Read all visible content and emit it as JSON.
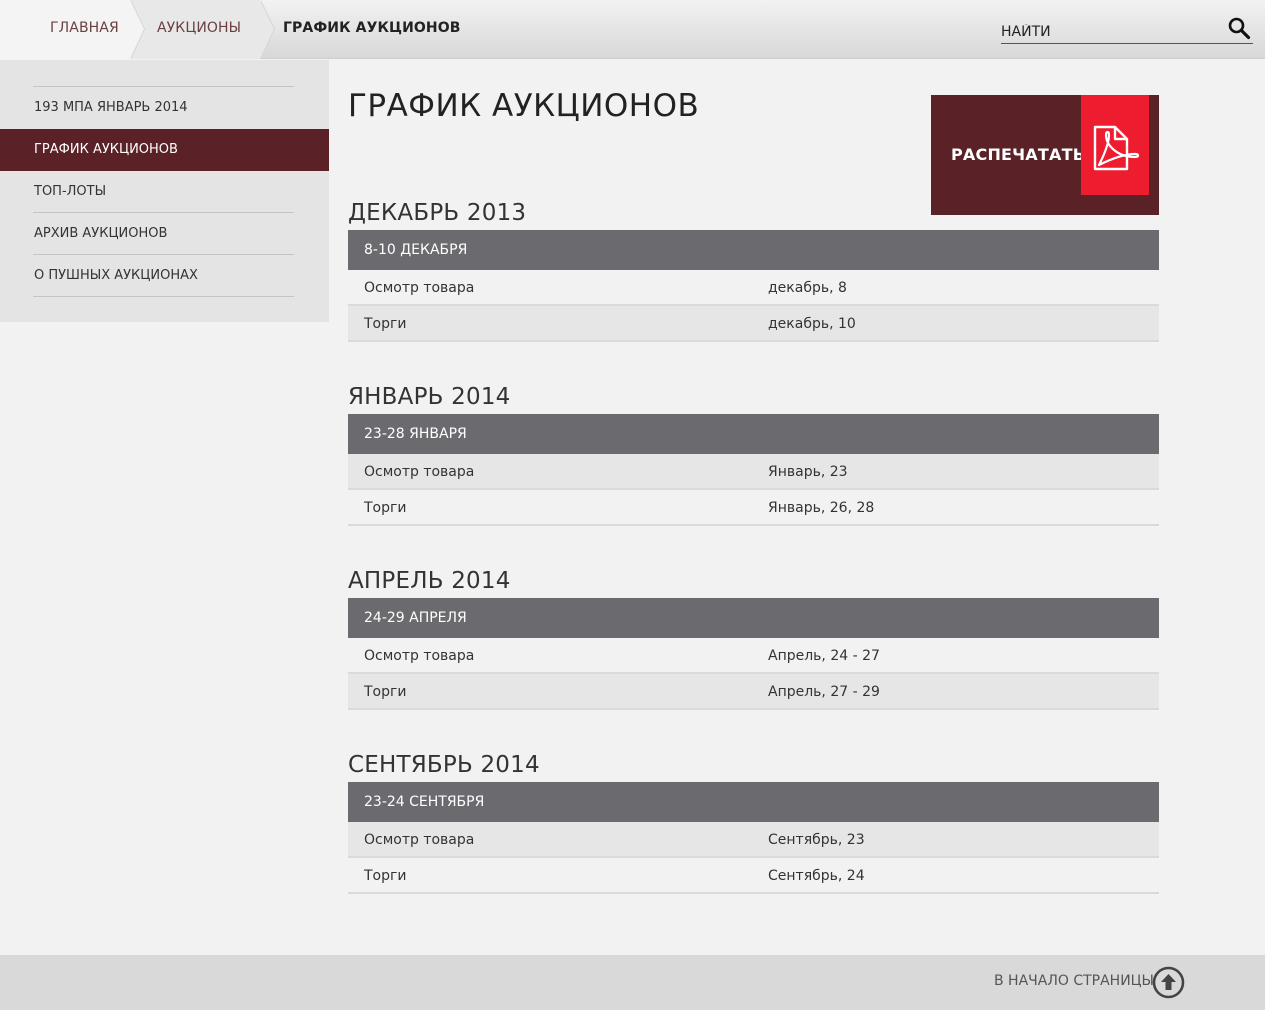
{
  "breadcrumb": {
    "home": "ГЛАВНАЯ",
    "auctions": "АУКЦИОНЫ",
    "current": "ГРАФИК АУКЦИОНОВ"
  },
  "search": {
    "placeholder": "НАЙТИ",
    "icon": "search-icon"
  },
  "sidebar": {
    "items": [
      {
        "label": "193 МПА ЯНВАРЬ 2014",
        "active": false
      },
      {
        "label": "ГРАФИК АУКЦИОНОВ",
        "active": true
      },
      {
        "label": "ТОП-ЛОТЫ",
        "active": false
      },
      {
        "label": "АРХИВ АУКЦИОНОВ",
        "active": false
      },
      {
        "label": "О ПУШНЫХ АУКЦИОНАХ",
        "active": false
      }
    ]
  },
  "main": {
    "title": "ГРАФИК АУКЦИОНОВ",
    "print_label": "РАСПЕЧАТАТЬ",
    "print_icon": "pdf-icon",
    "months": [
      {
        "title": "ДЕКАБРЬ 2013",
        "range": "8-10 ДЕКАБРЯ",
        "rows": [
          {
            "event": "Осмотр товара",
            "date": "декабрь, 8"
          },
          {
            "event": "Торги",
            "date": "декабрь, 10"
          }
        ]
      },
      {
        "title": "ЯНВАРЬ 2014",
        "range": "23-28 ЯНВАРЯ",
        "rows": [
          {
            "event": "Осмотр товара",
            "date": "Январь, 23"
          },
          {
            "event": "Торги",
            "date": "Январь, 26, 28"
          }
        ]
      },
      {
        "title": "АПРЕЛЬ 2014",
        "range": "24-29 АПРЕЛЯ",
        "rows": [
          {
            "event": "Осмотр товара",
            "date": "Апрель, 24 - 27"
          },
          {
            "event": "Торги",
            "date": "Апрель, 27 - 29"
          }
        ]
      },
      {
        "title": "СЕНТЯБРЬ 2014",
        "range": "23-24 СЕНТЯБРЯ",
        "rows": [
          {
            "event": "Осмотр товара",
            "date": "Сентябрь, 23"
          },
          {
            "event": "Торги",
            "date": "Сентябрь, 24"
          }
        ]
      }
    ]
  },
  "footer": {
    "to_top_label": "В НАЧАЛО СТРАНИЦЫ",
    "to_top_icon": "arrow-up-circle-icon"
  },
  "colors": {
    "accent": "#5a2127",
    "pdf_red": "#ed1c2e",
    "range_bar": "#6b6b6f"
  }
}
